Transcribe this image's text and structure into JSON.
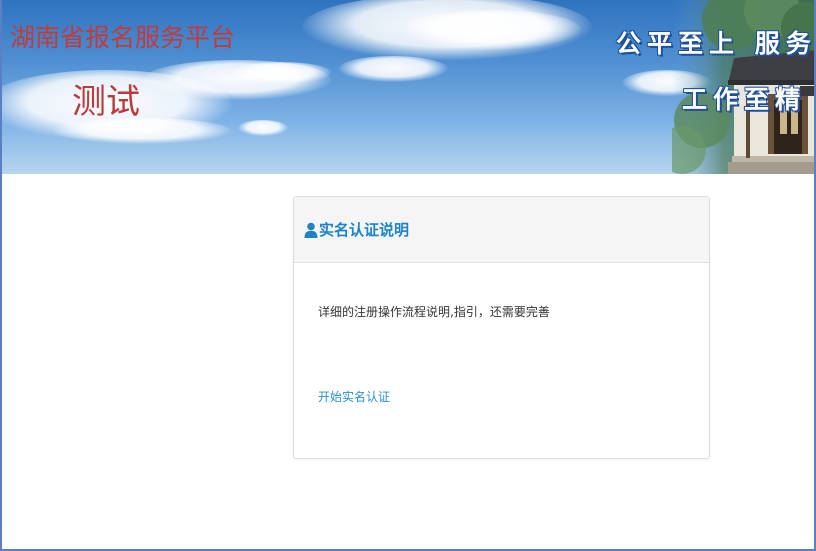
{
  "banner": {
    "site_title": "湖南省报名服务平台",
    "env_label": "测试",
    "slogan_line1": "公平至上 服务",
    "slogan_line2": "工作至精",
    "sky_color": "#4f8fd2"
  },
  "card": {
    "icon": "user-icon",
    "title": "实名认证说明",
    "description": "详细的注册操作流程说明,指引，还需要完善",
    "start_link": "开始实名认证",
    "title_color": "#1c84c6",
    "link_color": "#2a8fd8"
  }
}
